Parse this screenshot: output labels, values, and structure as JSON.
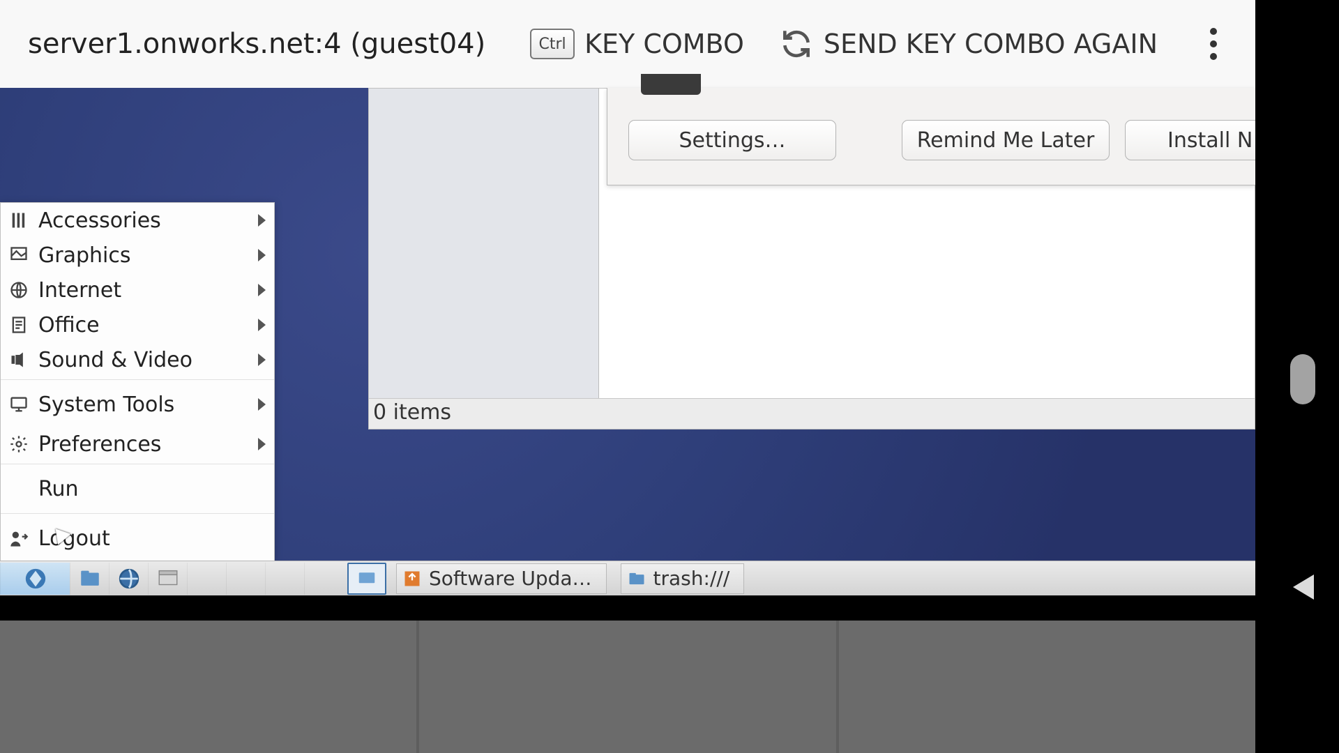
{
  "topbar": {
    "title": "server1.onworks.net:4 (guest04)",
    "ctrl_label": "Ctrl",
    "key_combo": "KEY COMBO",
    "send_again": "SEND KEY COMBO AGAIN"
  },
  "dialog": {
    "settings": "Settings…",
    "remind": "Remind Me Later",
    "install": "Install N"
  },
  "filemanager": {
    "status": "0 items"
  },
  "menu": {
    "items": [
      {
        "label": "Accessories",
        "icon": "accessories",
        "submenu": true
      },
      {
        "label": "Graphics",
        "icon": "graphics",
        "submenu": true
      },
      {
        "label": "Internet",
        "icon": "internet",
        "submenu": true
      },
      {
        "label": "Office",
        "icon": "office",
        "submenu": true
      },
      {
        "label": "Sound & Video",
        "icon": "sound-video",
        "submenu": true
      },
      {
        "label": "System Tools",
        "icon": "system-tools",
        "submenu": true
      },
      {
        "label": "Preferences",
        "icon": "preferences",
        "submenu": true
      },
      {
        "label": "Run",
        "icon": "",
        "submenu": false
      },
      {
        "label": "Logout",
        "icon": "logout",
        "submenu": false
      }
    ]
  },
  "taskbar": {
    "tasks": [
      {
        "label": "Software Upda…",
        "icon": "updater"
      },
      {
        "label": "trash:///",
        "icon": "folder"
      }
    ]
  }
}
